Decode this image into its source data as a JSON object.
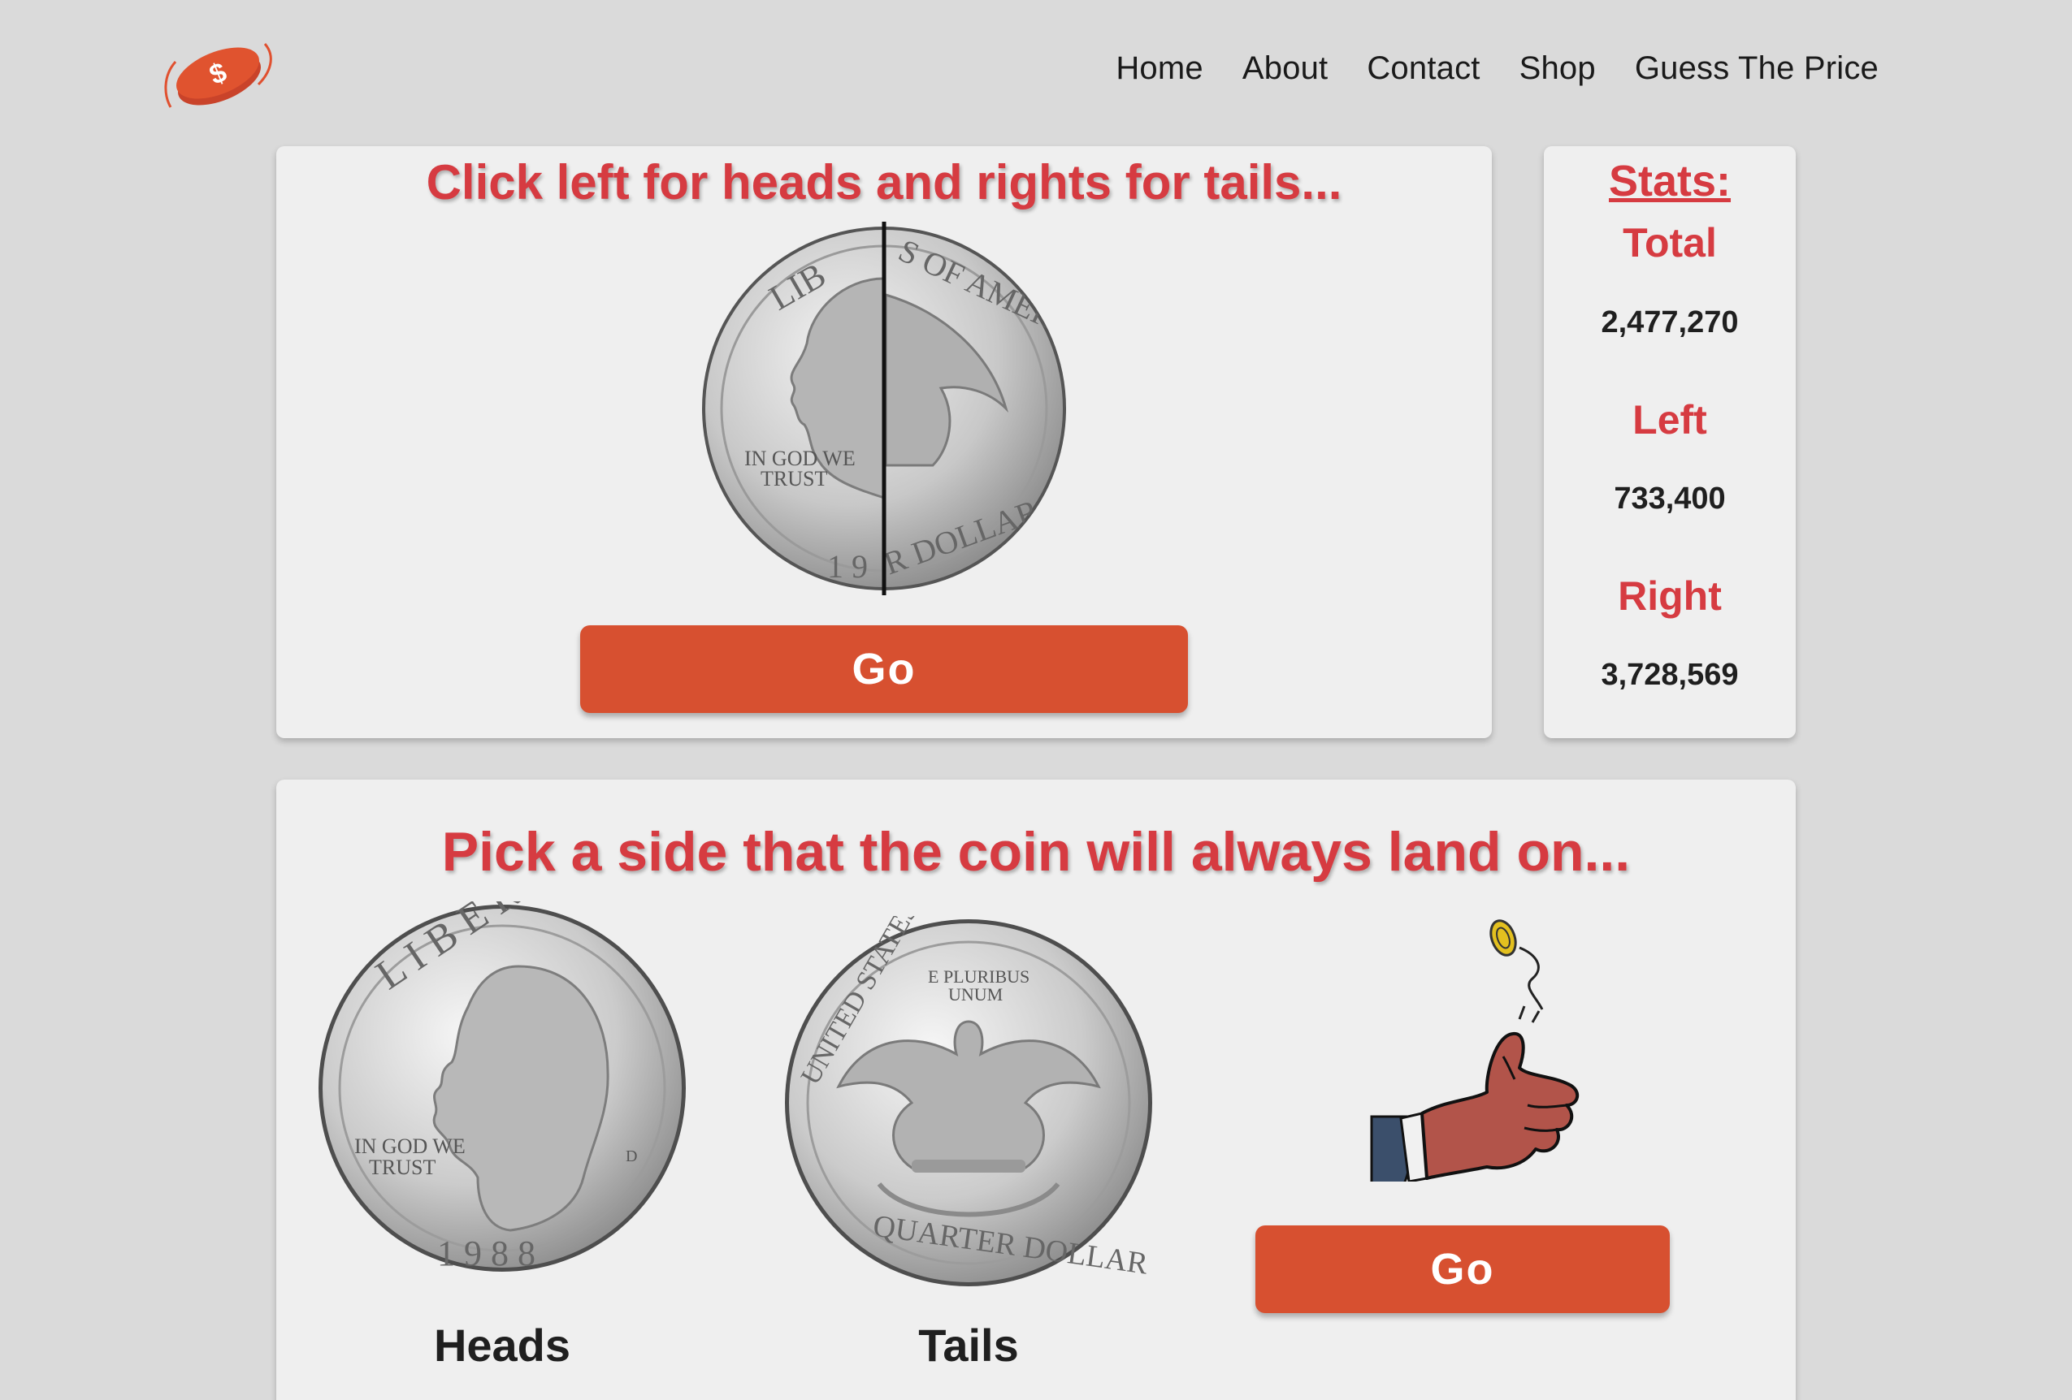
{
  "header": {
    "logo_icon": "coin-dollar-logo-icon",
    "nav": [
      {
        "label": "Home"
      },
      {
        "label": "About"
      },
      {
        "label": "Contact"
      },
      {
        "label": "Shop"
      },
      {
        "label": "Guess The Price"
      }
    ]
  },
  "split_game": {
    "heading": "Click left for heads and rights for tails...",
    "coin_icon": "split-quarter-coin-icon",
    "go_label": "Go"
  },
  "stats": {
    "title": "Stats:",
    "items": [
      {
        "label": "Total",
        "value": "2,477,270"
      },
      {
        "label": "Left",
        "value": "733,400"
      },
      {
        "label": "Right",
        "value": "3,728,569"
      }
    ]
  },
  "pick_game": {
    "heading": "Pick a side that the coin will always land on...",
    "heads_label": "Heads",
    "tails_label": "Tails",
    "hand_icon": "coin-flip-hand-icon",
    "go_label": "Go"
  },
  "colors": {
    "accent_red": "#d63b41",
    "button_orange": "#d75030",
    "background": "#dadada",
    "card": "#efefef"
  }
}
